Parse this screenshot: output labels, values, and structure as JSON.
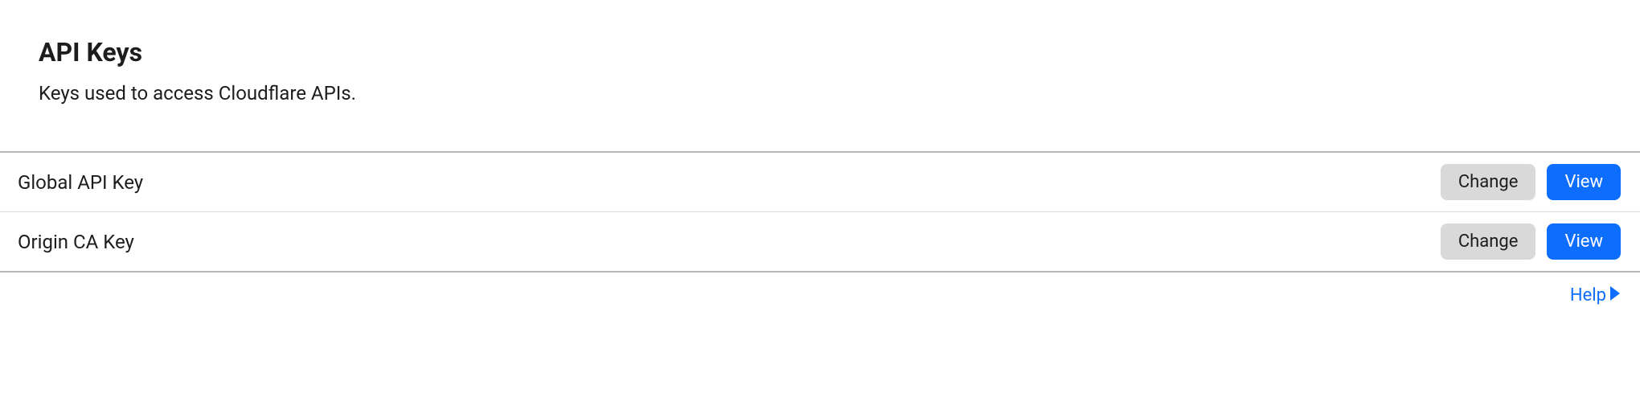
{
  "section": {
    "title": "API Keys",
    "subtitle": "Keys used to access Cloudflare APIs."
  },
  "keys": [
    {
      "name": "Global API Key",
      "change_label": "Change",
      "view_label": "View"
    },
    {
      "name": "Origin CA Key",
      "change_label": "Change",
      "view_label": "View"
    }
  ],
  "help": {
    "label": "Help"
  }
}
